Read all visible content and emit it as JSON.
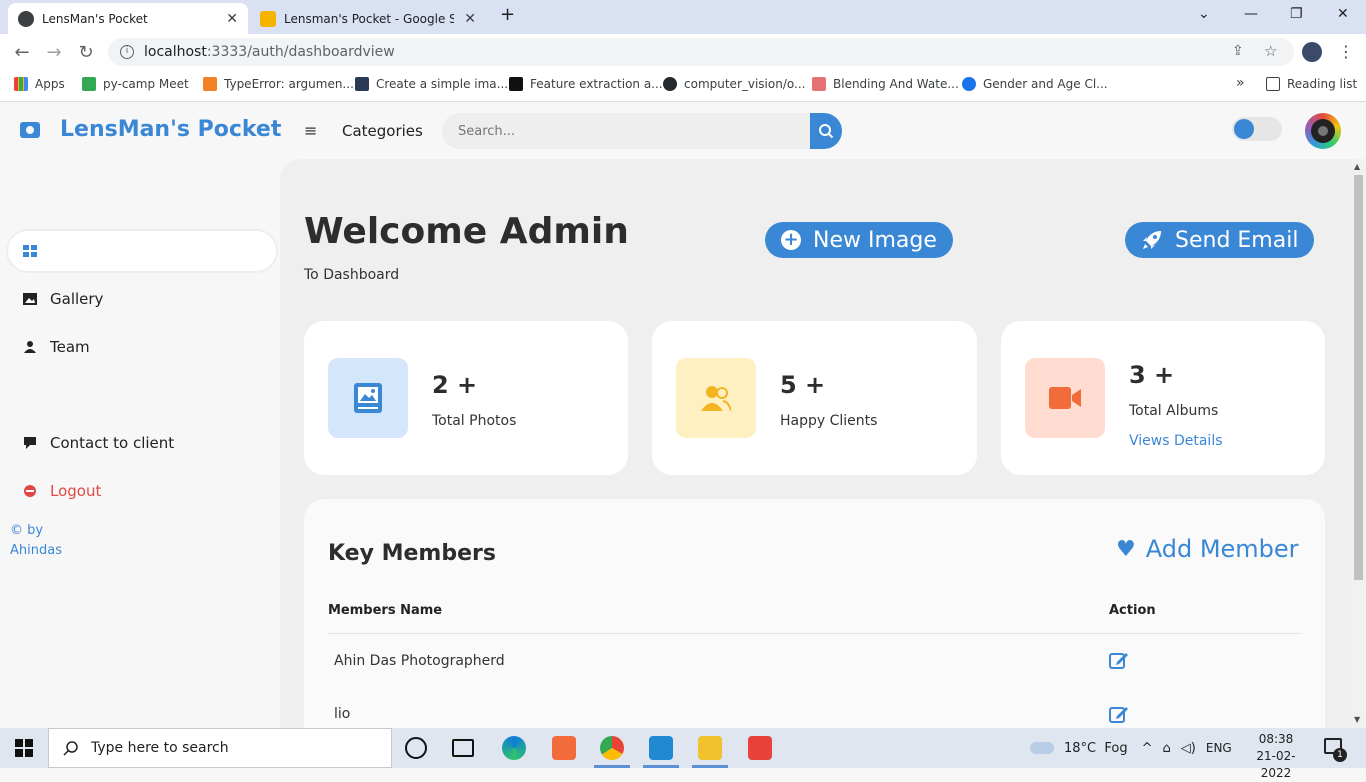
{
  "browser": {
    "tabs": [
      {
        "title": "LensMan's Pocket",
        "active": true
      },
      {
        "title": "Lensman's Pocket - Google Slides",
        "active": false
      }
    ],
    "new_tab_label": "+",
    "url_host": "localhost",
    "url_path": ":3333/auth/dashboardview",
    "bookmarks": [
      {
        "label": "Apps",
        "color": "#4285f4"
      },
      {
        "label": "py-camp Meet",
        "color": "#34a853"
      },
      {
        "label": "TypeError: argumen...",
        "color": "#f48024"
      },
      {
        "label": "Create a simple ima...",
        "color": "#2b3a55"
      },
      {
        "label": "Feature extraction a...",
        "color": "#111111"
      },
      {
        "label": "computer_vision/o...",
        "color": "#24292e"
      },
      {
        "label": "Blending And Wate...",
        "color": "#e57373"
      },
      {
        "label": "Gender and Age Cl...",
        "color": "#1a73e8"
      }
    ],
    "more_bookmarks": "»",
    "reading_list": "Reading list"
  },
  "app": {
    "brand": "LensMan's Pocket",
    "categories": "Categories",
    "search_placeholder": "Search...",
    "accent": "#3a87d6"
  },
  "sidebar": {
    "items": [
      {
        "label": "",
        "icon": "dashboard-icon",
        "active": true
      },
      {
        "label": "Gallery",
        "icon": "image-icon"
      },
      {
        "label": "Team",
        "icon": "user-icon"
      },
      {
        "label": "Contact to client",
        "icon": "chat-icon"
      },
      {
        "label": "Logout",
        "icon": "logout-icon",
        "color": "#e04848"
      }
    ],
    "copyright": "© by Ahindas"
  },
  "main": {
    "welcome": "Welcome Admin",
    "subtitle": "To Dashboard",
    "new_image": "New Image",
    "send_email": "Send Email",
    "stats": [
      {
        "value": "2 +",
        "label": "Total Photos",
        "icon": "image-icon",
        "bg": "#d3e6fb",
        "fg": "#3a87d6"
      },
      {
        "value": "5 +",
        "label": "Happy Clients",
        "icon": "users-icon",
        "bg": "#fff0c2",
        "fg": "#f3b521"
      },
      {
        "value": "3 +",
        "label": "Total Albums",
        "link": "Views Details",
        "icon": "video-camera-icon",
        "bg": "#ffdccf",
        "fg": "#f26b3a"
      }
    ],
    "members": {
      "title": "Key Members",
      "add_label": "Add Member",
      "col_name": "Members Name",
      "col_action": "Action",
      "rows": [
        {
          "name": "Ahin Das Photographerd"
        },
        {
          "name": "lio"
        }
      ]
    }
  },
  "taskbar": {
    "search_placeholder": "Type here to search",
    "weather": "18°C  Fog",
    "lang": "ENG",
    "time": "08:38",
    "date": "21-02-2022",
    "notifications": "1"
  }
}
